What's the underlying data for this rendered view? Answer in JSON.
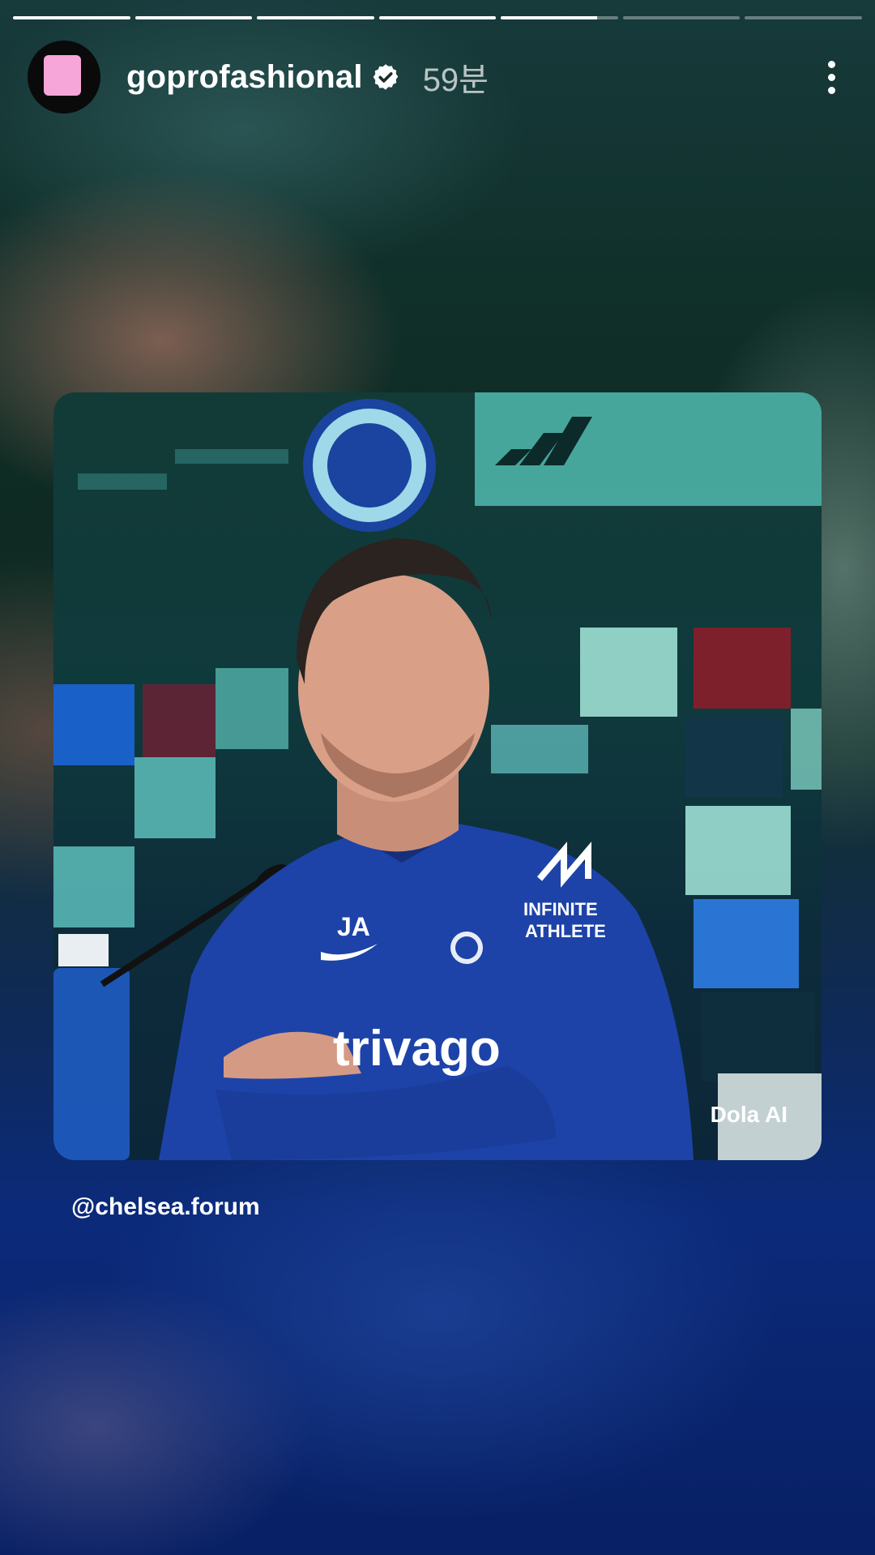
{
  "story": {
    "segments_total": 7,
    "segments_progress": [
      1,
      1,
      1,
      1,
      0.82,
      0,
      0
    ]
  },
  "header": {
    "username": "goprofashional",
    "verified_icon": "verified-badge-icon",
    "time_ago": "59분",
    "more_icon": "more-vertical-icon"
  },
  "post": {
    "watermark": "Dola AI",
    "jacket_initials": "JA",
    "jacket_sponsor": "trivago",
    "sleeve_text_1": "INFINITE",
    "sleeve_text_2": "ATHLETE"
  },
  "mention": "@chelsea.forum",
  "colors": {
    "accent_pink": "#f6a6d8",
    "jacket_blue": "#1d43a8"
  }
}
